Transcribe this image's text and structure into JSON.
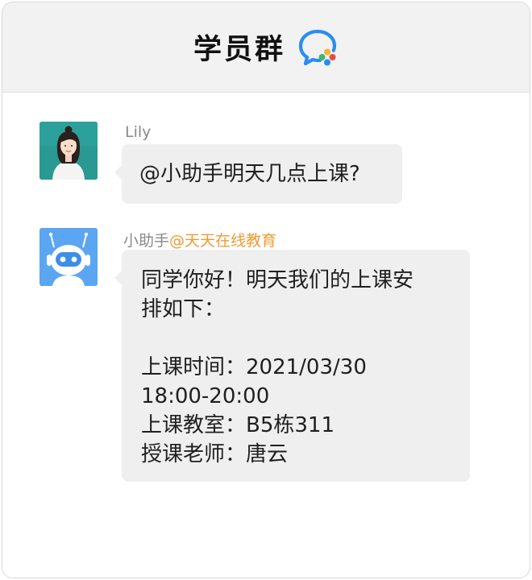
{
  "header": {
    "title": "学员群",
    "icon": "wecom-chat-icon"
  },
  "colors": {
    "header_bg": "#f2f2f2",
    "bubble_bg": "#efefef",
    "org_tag": "#f29a30",
    "sender_name": "#8a8a8a"
  },
  "messages": [
    {
      "sender": "Lily",
      "avatar": "user-photo-avatar",
      "text": "@小助手明天几点上课?"
    },
    {
      "sender": "小助手",
      "org_tag": "@天天在线教育",
      "avatar": "robot-avatar",
      "lines": {
        "l1": "同学你好！明天我们的上课安",
        "l2": "排如下：",
        "l3": "上课时间：2021/03/30",
        "l4": "18:00-20:00",
        "l5": "上课教室：B5栋311",
        "l6": "授课老师：唐云"
      }
    }
  ]
}
